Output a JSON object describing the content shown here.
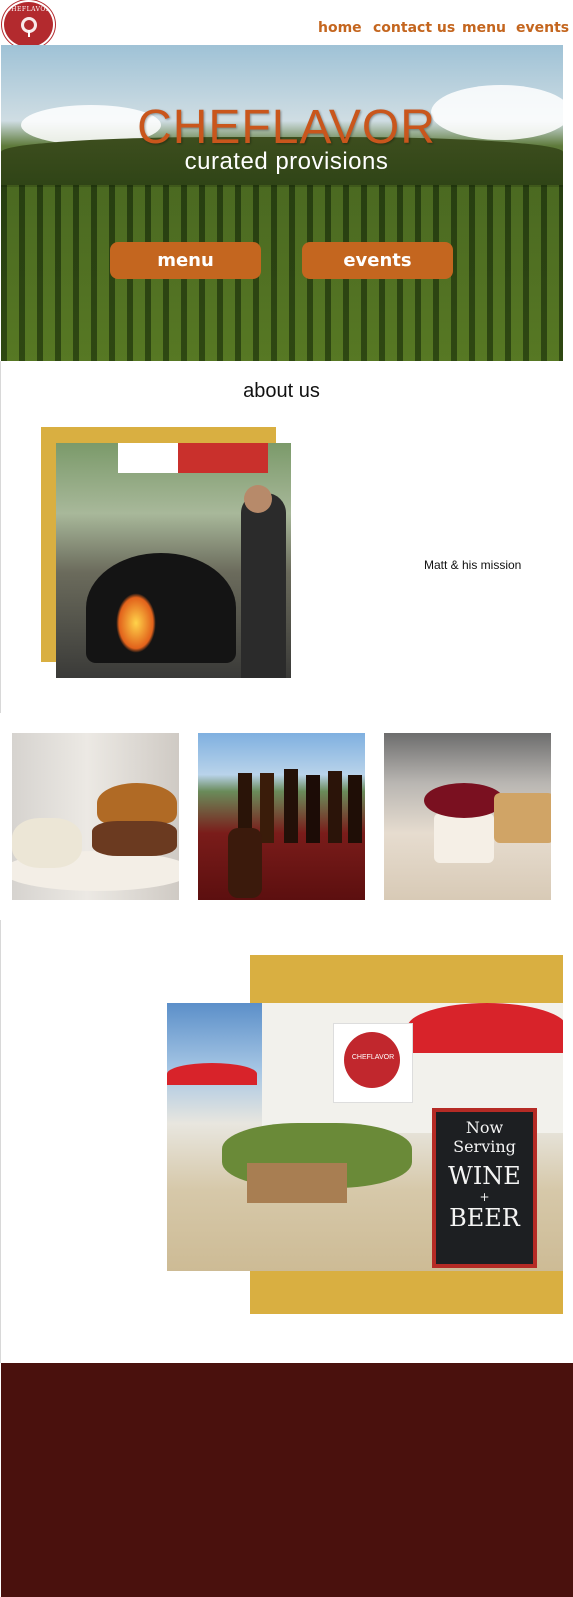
{
  "header": {
    "logo_text": "CHEFLAVOR",
    "nav": [
      "home",
      "contact us",
      "menu",
      "events"
    ]
  },
  "hero": {
    "brand": "CHEFLAVOR",
    "tagline": "curated provisions",
    "buttons": [
      "menu",
      "events"
    ]
  },
  "about": {
    "title": "about us",
    "mission": "Matt &  his mission"
  },
  "patio": {
    "flag_text": "CHEFLAVOR",
    "sign_lines": [
      "Now",
      "Serving",
      "WINE",
      "+",
      "BEER"
    ]
  },
  "colors": {
    "accent": "#c4661f",
    "brand_red": "#b32a2e",
    "gold": "#d9af41",
    "footer": "#4a110d"
  }
}
